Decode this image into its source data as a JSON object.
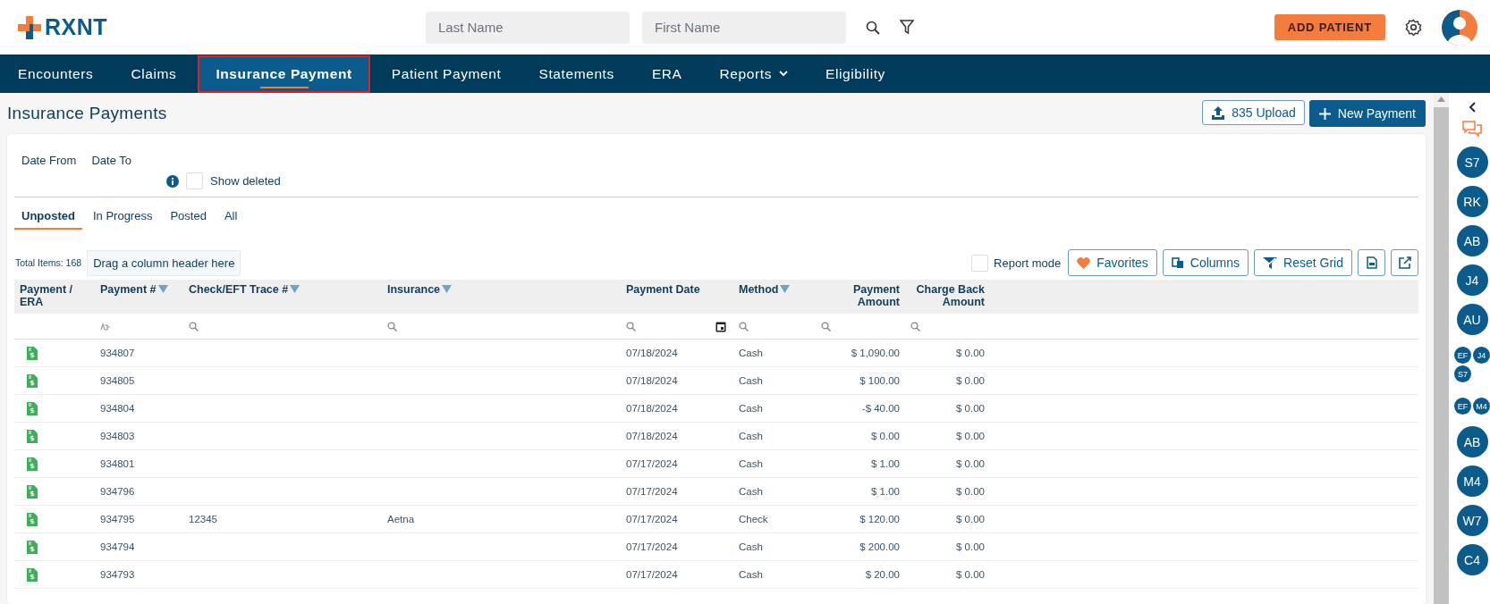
{
  "header": {
    "logo": "RXNT",
    "last_name": {
      "placeholder": "Last Name"
    },
    "first_name": {
      "placeholder": "First Name"
    },
    "add_patient": "ADD PATIENT"
  },
  "nav": [
    {
      "label": "Encounters",
      "selected": false,
      "has_menu": false
    },
    {
      "label": "Claims",
      "selected": false,
      "has_menu": false
    },
    {
      "label": "Insurance Payment",
      "selected": true,
      "has_menu": false
    },
    {
      "label": "Patient Payment",
      "selected": false,
      "has_menu": false
    },
    {
      "label": "Statements",
      "selected": false,
      "has_menu": false
    },
    {
      "label": "ERA",
      "selected": false,
      "has_menu": false
    },
    {
      "label": "Reports",
      "selected": false,
      "has_menu": true
    },
    {
      "label": "Eligibility",
      "selected": false,
      "has_menu": false
    }
  ],
  "page_title": "Insurance Payments",
  "actions": {
    "upload": "835 Upload",
    "new_payment": "New Payment"
  },
  "filters": {
    "date_from": "Date From",
    "date_to": "Date To",
    "show_deleted": {
      "label": "Show deleted",
      "checked": false
    }
  },
  "tabs": [
    {
      "label": "Unposted",
      "selected": true
    },
    {
      "label": "In Progress",
      "selected": false
    },
    {
      "label": "Posted",
      "selected": false
    },
    {
      "label": "All",
      "selected": false
    }
  ],
  "toolbar": {
    "total_items": "Total Items: 168",
    "group_drop": "Drag a column header here",
    "report_mode": {
      "label": "Report mode",
      "checked": false
    },
    "favorites": "Favorites",
    "columns": "Columns",
    "reset_grid": "Reset Grid"
  },
  "table": {
    "columns": [
      {
        "title": "Payment / ERA",
        "filterable": false,
        "kind": "icon"
      },
      {
        "title": "Payment #",
        "filterable": true,
        "kind": "id"
      },
      {
        "title": "Check/EFT Trace #",
        "filterable": true,
        "kind": "text"
      },
      {
        "title": "Insurance",
        "filterable": true,
        "kind": "text"
      },
      {
        "title": "Payment Date",
        "filterable": false,
        "kind": "date"
      },
      {
        "title": "Method",
        "filterable": true,
        "kind": "text"
      },
      {
        "title": "Payment Amount",
        "filterable": false,
        "kind": "number"
      },
      {
        "title": "Charge Back Amount",
        "filterable": false,
        "kind": "number"
      }
    ],
    "rows": [
      {
        "payment_no": "934807",
        "date": "07/18/2024",
        "method": "Cash",
        "amount": "$ 1,090.00",
        "charge_back": "$ 0.00"
      },
      {
        "payment_no": "934805",
        "date": "07/18/2024",
        "method": "Cash",
        "amount": "$ 100.00",
        "charge_back": "$ 0.00"
      },
      {
        "payment_no": "934804",
        "date": "07/18/2024",
        "method": "Cash",
        "amount": "-$ 40.00",
        "charge_back": "$ 0.00"
      },
      {
        "payment_no": "934803",
        "date": "07/18/2024",
        "method": "Cash",
        "amount": "$ 0.00",
        "charge_back": "$ 0.00"
      },
      {
        "payment_no": "934801",
        "date": "07/17/2024",
        "method": "Cash",
        "amount": "$ 1.00",
        "charge_back": "$ 0.00"
      },
      {
        "payment_no": "934796",
        "date": "07/17/2024",
        "method": "Cash",
        "amount": "$ 1.00",
        "charge_back": "$ 0.00"
      },
      {
        "payment_no": "934795",
        "trace": "12345",
        "insurance": "Aetna",
        "date": "07/17/2024",
        "method": "Check",
        "amount": "$ 120.00",
        "charge_back": "$ 0.00"
      },
      {
        "payment_no": "934794",
        "date": "07/17/2024",
        "method": "Cash",
        "amount": "$ 200.00",
        "charge_back": "$ 0.00"
      },
      {
        "payment_no": "934793",
        "date": "07/17/2024",
        "method": "Cash",
        "amount": "$ 20.00",
        "charge_back": "$ 0.00"
      }
    ]
  },
  "rail": [
    {
      "kind": "single",
      "initials": [
        "S7"
      ]
    },
    {
      "kind": "single",
      "initials": [
        "RK"
      ]
    },
    {
      "kind": "single",
      "initials": [
        "AB"
      ]
    },
    {
      "kind": "single",
      "initials": [
        "J4"
      ]
    },
    {
      "kind": "single",
      "initials": [
        "AU"
      ]
    },
    {
      "kind": "group",
      "initials": [
        "EF",
        "J4",
        "S7"
      ]
    },
    {
      "kind": "group",
      "initials": [
        "EF",
        "M4"
      ]
    },
    {
      "kind": "single",
      "initials": [
        "AB"
      ]
    },
    {
      "kind": "single",
      "initials": [
        "M4"
      ]
    },
    {
      "kind": "single",
      "initials": [
        "W7"
      ]
    },
    {
      "kind": "single",
      "initials": [
        "C4"
      ]
    }
  ]
}
